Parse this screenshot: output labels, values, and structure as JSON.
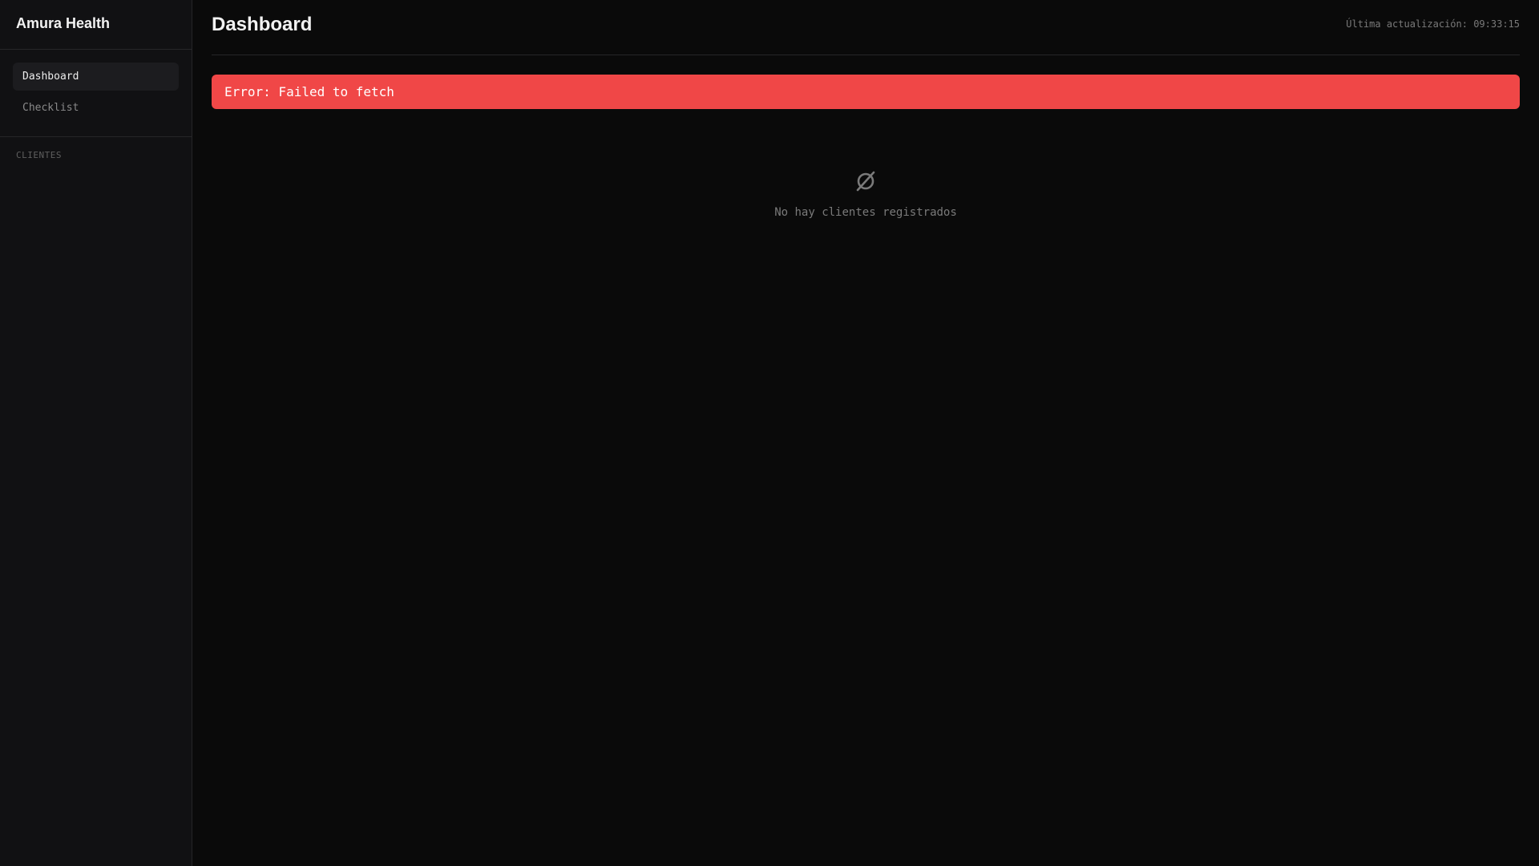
{
  "app": {
    "title": "Amura Health"
  },
  "sidebar": {
    "nav": [
      {
        "label": "Dashboard",
        "active": true
      },
      {
        "label": "Checklist",
        "active": false
      }
    ],
    "section_label": "CLIENTES"
  },
  "header": {
    "title": "Dashboard",
    "last_update": "Última actualización: 09:33:15"
  },
  "error": {
    "message": "Error: Failed to fetch",
    "color": "#f04747"
  },
  "empty_state": {
    "icon": "empty-set-icon",
    "text": "No hay clientes registrados"
  }
}
